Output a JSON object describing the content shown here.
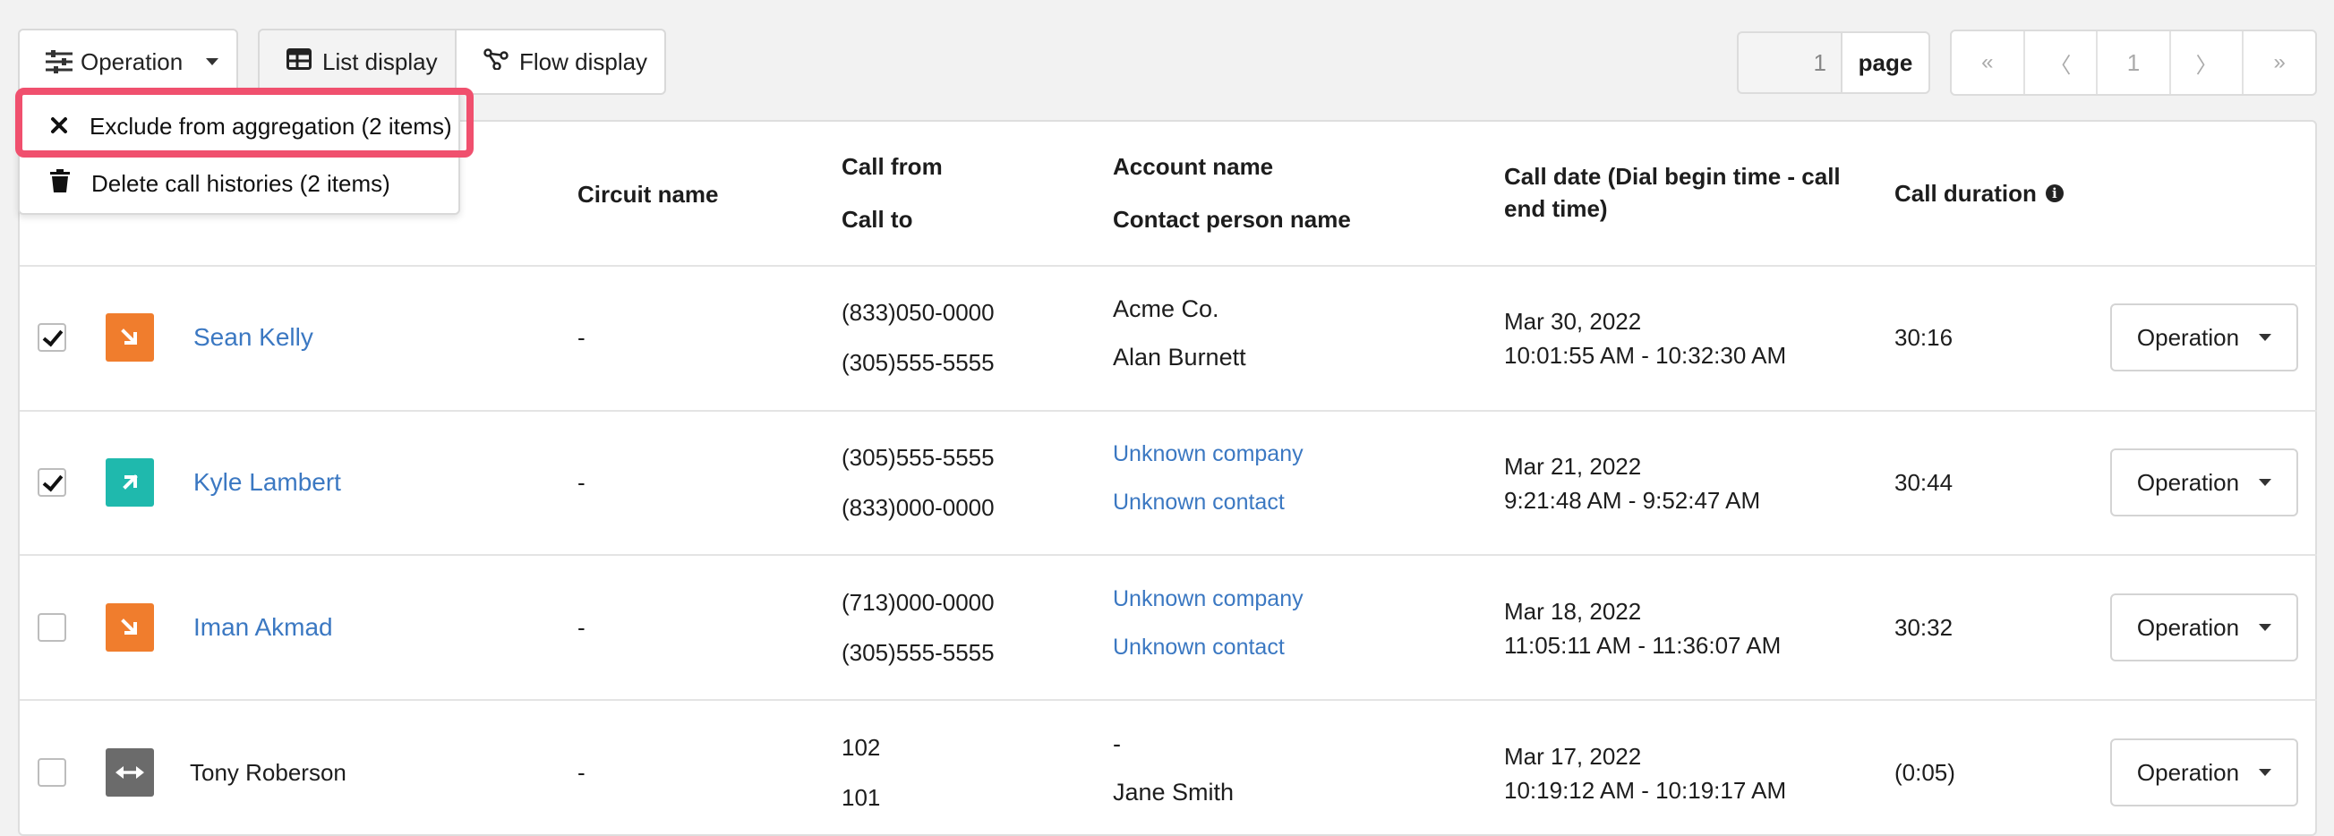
{
  "toolbar": {
    "operation_label": "Operation",
    "list_display_label": "List display",
    "flow_display_label": "Flow display"
  },
  "pagination": {
    "page_input_value": "1",
    "page_label": "page",
    "first": "«",
    "prev": "〈",
    "current": "1",
    "next": "〉",
    "last": "»"
  },
  "dropdown": {
    "items": [
      {
        "label": "Exclude from aggregation (2 items)",
        "icon": "x-icon"
      },
      {
        "label": "Delete call histories (2 items)",
        "icon": "trash-icon"
      }
    ]
  },
  "table": {
    "headers": {
      "circuit": "Circuit name",
      "call_from": "Call from",
      "call_to": "Call to",
      "account": "Account name",
      "contact": "Contact person name",
      "date": "Call date (Dial begin time - call end time)",
      "duration": "Call duration"
    },
    "rows": [
      {
        "checked": true,
        "direction": "incoming",
        "dir_color": "#f07d2d",
        "name": "Sean Kelly",
        "name_link": true,
        "circuit": "-",
        "from_prefix": "(833)",
        "from_rest": "050-0000",
        "to_prefix": "(305)",
        "to_rest": "555-5555",
        "account": "Acme Co.",
        "account_link": false,
        "contact": "Alan Burnett",
        "contact_link": false,
        "date": "Mar 30, 2022",
        "time": "10:01:55 AM - 10:32:30 AM",
        "duration": "30:16",
        "op_label": "Operation"
      },
      {
        "checked": true,
        "direction": "outgoing",
        "dir_color": "#1fb9ad",
        "name": "Kyle Lambert",
        "name_link": true,
        "circuit": "-",
        "from_prefix": "(305)",
        "from_rest": "555-5555",
        "to_prefix": "(833)",
        "to_rest": "000-0000",
        "account": "Unknown company",
        "account_link": true,
        "contact": "Unknown contact",
        "contact_link": true,
        "date": "Mar 21, 2022",
        "time": "9:21:48 AM - 9:52:47 AM",
        "duration": "30:44",
        "op_label": "Operation"
      },
      {
        "checked": false,
        "direction": "incoming",
        "dir_color": "#f07d2d",
        "name": "Iman Akmad",
        "name_link": true,
        "circuit": "-",
        "from_prefix": "(713)",
        "from_rest": "000-0000",
        "to_prefix": "(305)",
        "to_rest": "555-5555",
        "account": "Unknown company",
        "account_link": true,
        "contact": "Unknown contact",
        "contact_link": true,
        "date": "Mar 18, 2022",
        "time": "11:05:11 AM - 11:36:07 AM",
        "duration": "30:32",
        "op_label": "Operation"
      },
      {
        "checked": false,
        "direction": "internal",
        "dir_color": "#6b6b6b",
        "name": "Tony Roberson",
        "name_link": false,
        "circuit": "-",
        "from_prefix": "",
        "from_rest": "102",
        "to_prefix": "",
        "to_rest": "101",
        "account": "-",
        "account_link": false,
        "contact": "Jane Smith",
        "contact_link": false,
        "date": "Mar 17, 2022",
        "time": "10:19:12 AM - 10:19:17 AM",
        "duration": "(0:05)",
        "op_label": "Operation"
      }
    ]
  },
  "colors": {
    "link": "#3b78c2",
    "highlight": "#f0506e",
    "incoming": "#f07d2d",
    "outgoing": "#1fb9ad",
    "internal": "#6b6b6b"
  }
}
